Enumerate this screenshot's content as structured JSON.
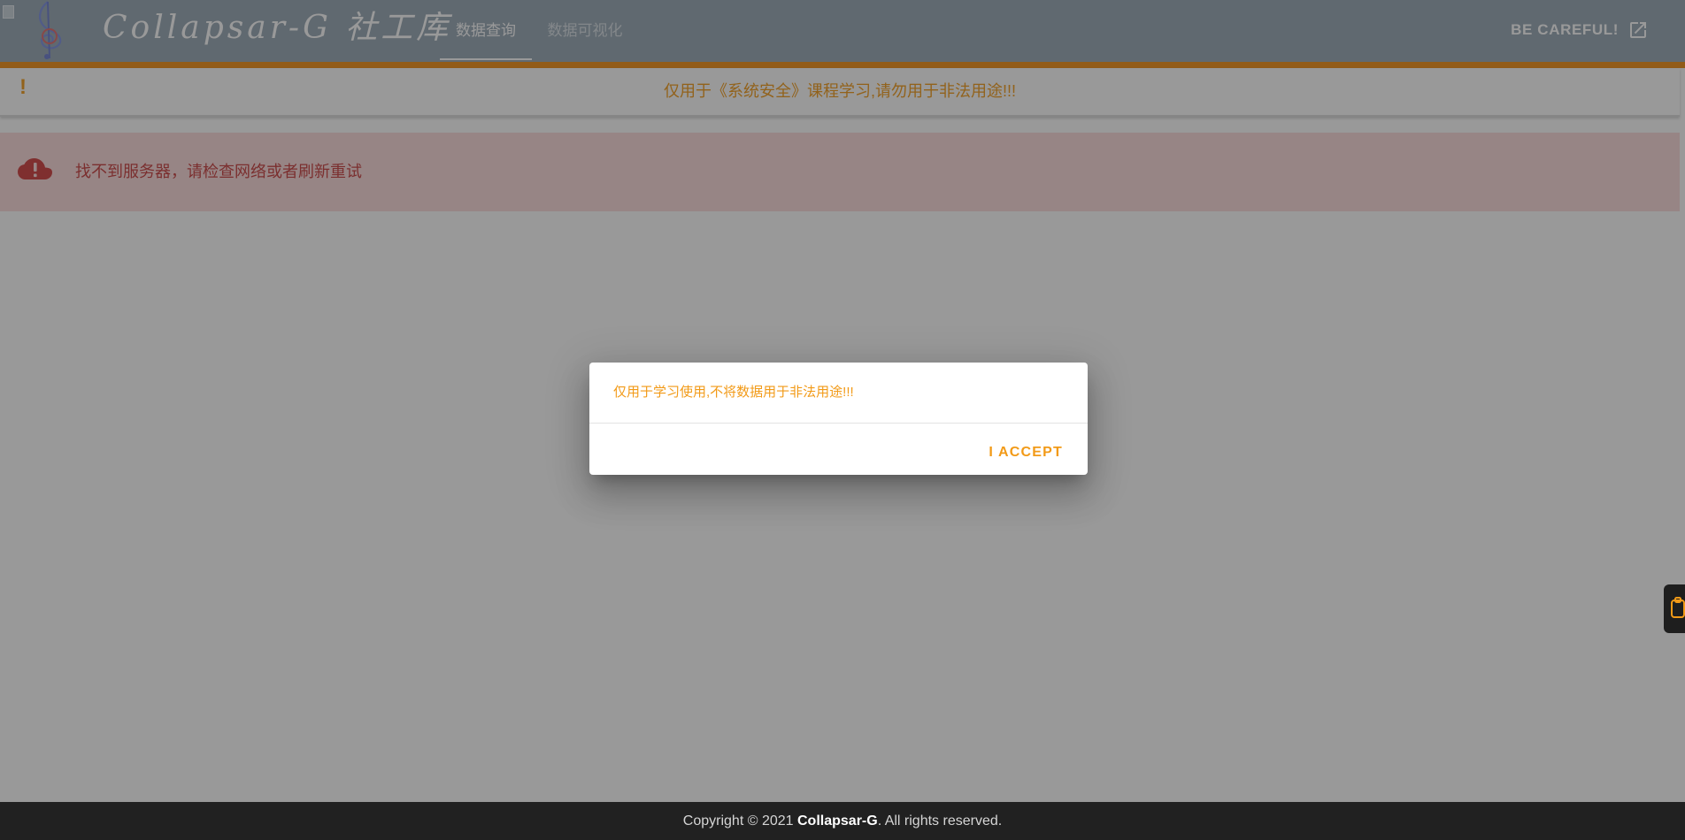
{
  "header": {
    "brand": "Collapsar-G 社工库",
    "tabs": [
      {
        "label": "数据查询",
        "active": true
      },
      {
        "label": "数据可视化",
        "active": false
      }
    ],
    "careful_link": {
      "label": "BE CAREFUL!",
      "icon": "open-in-new-icon"
    },
    "logo_icon": "treble-clef-logo",
    "color": "#97a7b4",
    "accent_color": "#f28c12"
  },
  "warning_banner": {
    "bang": "!",
    "text": "仅用于《系统安全》课程学习,请勿用于非法用途!!!",
    "color": "#f29a17"
  },
  "error_alert": {
    "icon": "cloud-alert-icon",
    "text": "找不到服务器，请检查网络或者刷新重试",
    "color": "#c73b3b",
    "background": "#fbdada"
  },
  "dialog": {
    "message": "仅用于学习使用,不将数据用于非法用途!!!",
    "accept_label": "I ACCEPT"
  },
  "footer": {
    "prefix": "Copyright © 2021 ",
    "brand": "Collapsar-G",
    "suffix": ". All rights reserved."
  },
  "side_tab": {
    "icon": "clipboard-icon"
  }
}
